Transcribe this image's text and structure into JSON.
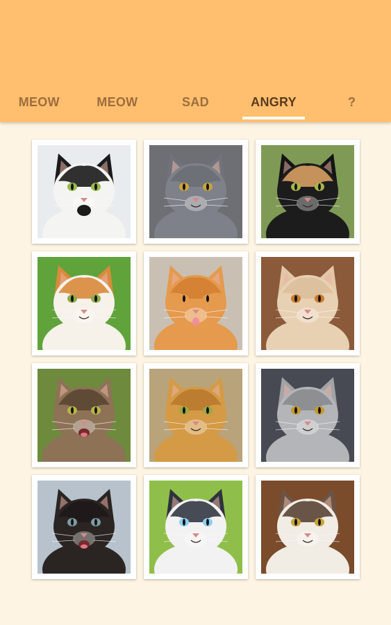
{
  "tabs": [
    {
      "label": "MEOW",
      "active": false
    },
    {
      "label": "MEOW",
      "active": false
    },
    {
      "label": "SAD",
      "active": false
    },
    {
      "label": "ANGRY",
      "active": true
    },
    {
      "label": "?",
      "active": false
    }
  ],
  "colors": {
    "appbar": "#ffbf6e",
    "background": "#fdf4e3",
    "tab_text": "#9d6d3f",
    "tab_text_active": "#5b3a1f",
    "indicator": "#ffffff"
  },
  "cats": [
    {
      "name": "black-white-cat",
      "bg": "#e9ecef",
      "fur": "#f4f4f2",
      "patch": "#1b1b1b",
      "ear": "#1b1b1b",
      "eyes": "#9ab84a",
      "mouth": "black"
    },
    {
      "name": "grey-cat",
      "bg": "#6d6f74",
      "fur": "#7e8189",
      "patch": "#6b6e76",
      "ear": "#70737b",
      "eyes": "#c9a43a",
      "mouth": "closed"
    },
    {
      "name": "calico-cat",
      "bg": "#7f9a55",
      "fur": "#1c1c1c",
      "patch": "#d8a063",
      "ear": "#141414",
      "eyes": "#a7b64a",
      "mouth": "closed"
    },
    {
      "name": "orange-white-cat",
      "bg": "#5fa33a",
      "fur": "#f6f2ea",
      "patch": "#d98a3c",
      "ear": "#d98a3c",
      "eyes": "#8faa4a",
      "mouth": "closed"
    },
    {
      "name": "orange-tabby-lying-cat",
      "bg": "#c9c0b3",
      "fur": "#e59a4e",
      "patch": "#d37f33",
      "ear": "#e59a4e",
      "eyes": "#e59a4e",
      "mouth": "tongue"
    },
    {
      "name": "cream-persian-cat",
      "bg": "#8b5a3a",
      "fur": "#e8d0b2",
      "patch": "#dcbf9c",
      "ear": "#e3c7a6",
      "eyes": "#c77b2f",
      "mouth": "closed"
    },
    {
      "name": "tabby-hissing-cat",
      "bg": "#6e8a3d",
      "fur": "#8e7256",
      "patch": "#5a4632",
      "ear": "#8e7256",
      "eyes": "#b7b446",
      "mouth": "open"
    },
    {
      "name": "orange-longhair-cat",
      "bg": "#b9a37a",
      "fur": "#d49a45",
      "patch": "#b97a2e",
      "ear": "#d49a45",
      "eyes": "#9ca843",
      "mouth": "closed"
    },
    {
      "name": "grey-persian-cat",
      "bg": "#474a52",
      "fur": "#b4b5b8",
      "patch": "#8a8b8f",
      "ear": "#a2a3a7",
      "eyes": "#c49a2f",
      "mouth": "closed"
    },
    {
      "name": "black-kitten",
      "bg": "#b7c2cc",
      "fur": "#2a2523",
      "patch": "#1e1a18",
      "ear": "#2a2523",
      "eyes": "#7f9aa3",
      "mouth": "open"
    },
    {
      "name": "siamese-blue-eyed-cat",
      "bg": "#8fbf4a",
      "fur": "#f2f2f2",
      "patch": "#333844",
      "ear": "#2f333d",
      "eyes": "#8ed0f0",
      "mouth": "closed"
    },
    {
      "name": "maine-coon-cat",
      "bg": "#7a4c2c",
      "fur": "#f1ece4",
      "patch": "#5a4536",
      "ear": "#6b5444",
      "eyes": "#c9a53a",
      "mouth": "closed"
    }
  ]
}
